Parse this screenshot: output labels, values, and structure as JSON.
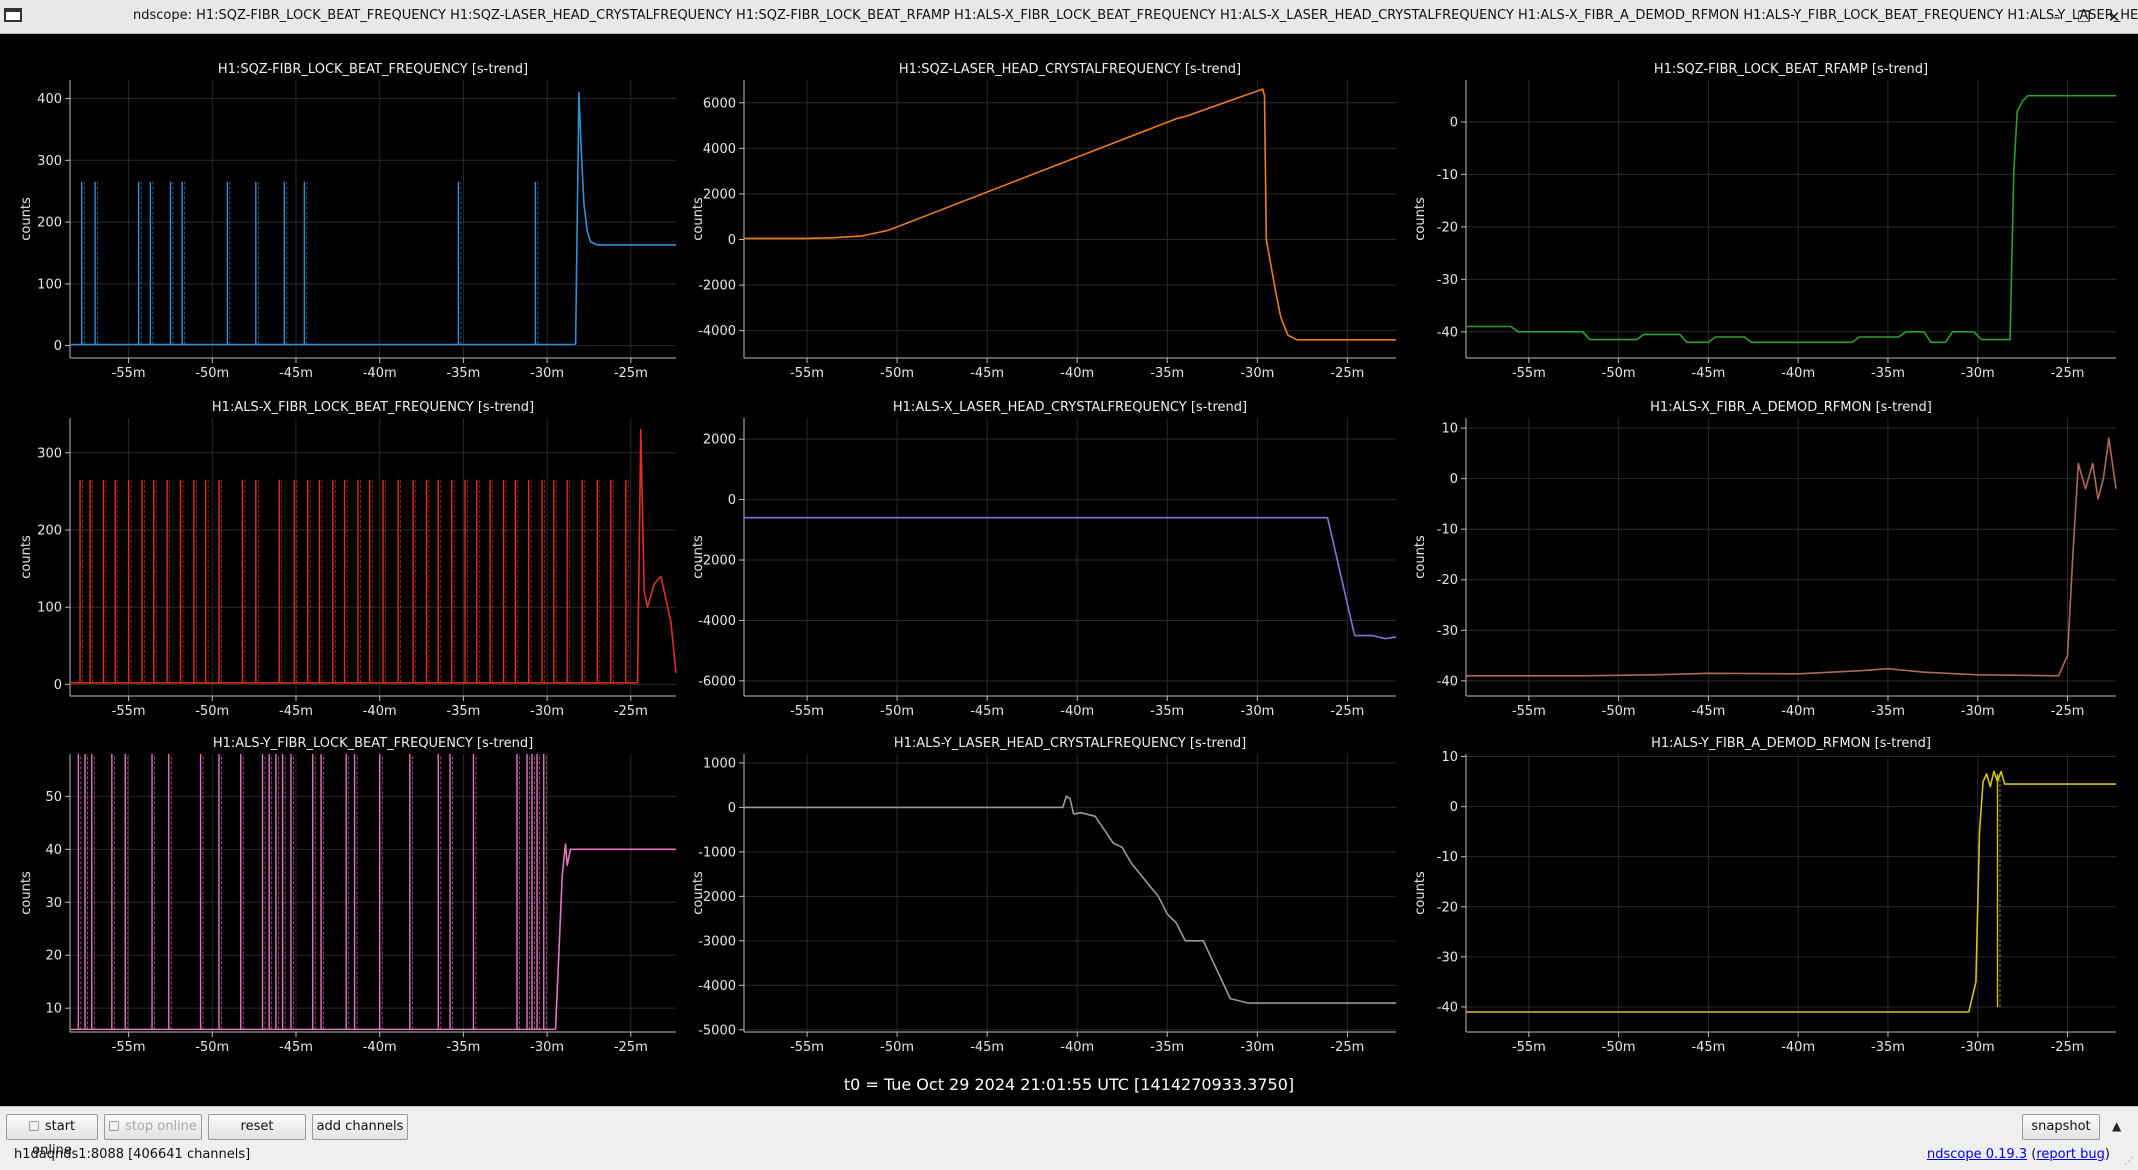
{
  "window": {
    "title": "ndscope: H1:SQZ-FIBR_LOCK_BEAT_FREQUENCY H1:SQZ-LASER_HEAD_CRYSTALFREQUENCY H1:SQZ-FIBR_LOCK_BEAT_RFAMP H1:ALS-X_FIBR_LOCK_BEAT_FREQUENCY H1:ALS-X_LASER_HEAD_CRYSTALFREQUENCY H1:ALS-X_FIBR_A_DEMOD_RFMON H1:ALS-Y_FIBR_LOCK_BEAT_FREQUENCY H1:ALS-Y_LASER_HEA",
    "controls": {
      "minimize": "–",
      "restore": "❐",
      "maximize": "□",
      "close": "✕"
    }
  },
  "t0_label": "t0 = Tue Oct 29 2024 21:01:55 UTC [1414270933.3750]",
  "buttons": {
    "start_online": "start online",
    "stop_online": "stop online",
    "reset": "reset",
    "add_channels": "add channels",
    "snapshot": "snapshot",
    "collapse": "▲"
  },
  "status": {
    "server": "h1daqnds1:8088  [406641 channels]",
    "app_link": "ndscope 0.19.3",
    "paren_open": " (",
    "bug_link": "report bug",
    "paren_close": ")"
  },
  "colors": {
    "background": "#000000",
    "grid": "#2a2a2a",
    "axis": "#bdbdbd"
  },
  "chart_data": [
    {
      "type": "line",
      "title": "H1:SQZ-FIBR_LOCK_BEAT_FREQUENCY [s-trend]",
      "ylabel": "counts",
      "color": "#2f8fd8",
      "xlim": [
        -58.5,
        -22.3
      ],
      "ylim": [
        -20,
        430
      ],
      "x_ticks": [
        -55,
        -50,
        -45,
        -40,
        -35,
        -30,
        -25
      ],
      "x_tick_labels": [
        "-55m",
        "-50m",
        "-45m",
        "-40m",
        "-35m",
        "-30m",
        "-25m"
      ],
      "y_ticks": [
        0,
        100,
        200,
        300,
        400
      ],
      "y_tick_labels": [
        "0",
        "100",
        "200",
        "300",
        "400"
      ],
      "baseline": 2,
      "spikes": [
        {
          "x": -57.8,
          "y": 265
        },
        {
          "x": -57.0,
          "y": 265
        },
        {
          "x": -54.4,
          "y": 265
        },
        {
          "x": -53.7,
          "y": 265
        },
        {
          "x": -52.5,
          "y": 265
        },
        {
          "x": -51.8,
          "y": 265
        },
        {
          "x": -49.1,
          "y": 265
        },
        {
          "x": -47.4,
          "y": 265
        },
        {
          "x": -45.7,
          "y": 265
        },
        {
          "x": -44.5,
          "y": 265
        },
        {
          "x": -35.3,
          "y": 265
        },
        {
          "x": -30.7,
          "y": 265
        }
      ],
      "series": [
        {
          "x": [
            -28.3,
            -28.1,
            -27.95,
            -27.8,
            -27.6,
            -27.4,
            -27.0,
            -26.0,
            -22.3
          ],
          "y": [
            2,
            410,
            310,
            230,
            185,
            168,
            163,
            163,
            163
          ]
        }
      ]
    },
    {
      "type": "line",
      "title": "H1:SQZ-LASER_HEAD_CRYSTALFREQUENCY [s-trend]",
      "ylabel": "counts",
      "color": "#f07d1c",
      "xlim": [
        -58.5,
        -22.3
      ],
      "ylim": [
        -5200,
        7000
      ],
      "x_ticks": [
        -55,
        -50,
        -45,
        -40,
        -35,
        -30,
        -25
      ],
      "x_tick_labels": [
        "-55m",
        "-50m",
        "-45m",
        "-40m",
        "-35m",
        "-30m",
        "-25m"
      ],
      "y_ticks": [
        -4000,
        -2000,
        0,
        2000,
        4000,
        6000
      ],
      "y_tick_labels": [
        "-4000",
        "-2000",
        "0",
        "2000",
        "4000",
        "6000"
      ],
      "series": [
        {
          "x": [
            -58.5,
            -55,
            -53.5,
            -52,
            -50.5,
            -34.5,
            -34,
            -29.7,
            -29.6,
            -29.5,
            -29.0,
            -28.7,
            -28.3,
            -27.8,
            -22.3
          ],
          "y": [
            50,
            50,
            80,
            150,
            400,
            5300,
            5400,
            6600,
            6300,
            0,
            -2200,
            -3400,
            -4200,
            -4400,
            -4400
          ]
        }
      ]
    },
    {
      "type": "line",
      "title": "H1:SQZ-FIBR_LOCK_BEAT_RFAMP [s-trend]",
      "ylabel": "counts",
      "color": "#2ca02c",
      "xlim": [
        -58.5,
        -22.3
      ],
      "ylim": [
        -45,
        8
      ],
      "x_ticks": [
        -55,
        -50,
        -45,
        -40,
        -35,
        -30,
        -25
      ],
      "x_tick_labels": [
        "-55m",
        "-50m",
        "-45m",
        "-40m",
        "-35m",
        "-30m",
        "-25m"
      ],
      "y_ticks": [
        -40,
        -30,
        -20,
        -10,
        0
      ],
      "y_tick_labels": [
        "-40",
        "-30",
        "-20",
        "-10",
        "0"
      ],
      "series": [
        {
          "x": [
            -58.5,
            -56,
            -55.6,
            -52,
            -51.6,
            -49,
            -48.6,
            -46.6,
            -46.2,
            -45.0,
            -44.6,
            -43,
            -42.6,
            -37,
            -36.6,
            -34.4,
            -34.0,
            -33,
            -32.6,
            -31.8,
            -31.4,
            -30.2,
            -29.8,
            -28.2,
            -28.0,
            -27.8,
            -27.5,
            -27.2,
            -26.8,
            -22.3
          ],
          "y": [
            -39,
            -39,
            -40,
            -40,
            -41.5,
            -41.5,
            -40.5,
            -40.5,
            -42,
            -42,
            -41,
            -41,
            -42,
            -42,
            -41,
            -41,
            -40,
            -40,
            -42,
            -42,
            -40,
            -40,
            -41.5,
            -41.5,
            -10,
            2,
            4,
            5,
            5,
            5
          ]
        }
      ]
    },
    {
      "type": "line",
      "title": "H1:ALS-X_FIBR_LOCK_BEAT_FREQUENCY [s-trend]",
      "ylabel": "counts",
      "color": "#e0301e",
      "xlim": [
        -58.5,
        -22.3
      ],
      "ylim": [
        -15,
        345
      ],
      "x_ticks": [
        -55,
        -50,
        -45,
        -40,
        -35,
        -30,
        -25
      ],
      "x_tick_labels": [
        "-55m",
        "-50m",
        "-45m",
        "-40m",
        "-35m",
        "-30m",
        "-25m"
      ],
      "y_ticks": [
        0,
        100,
        200,
        300
      ],
      "y_tick_labels": [
        "0",
        "100",
        "200",
        "300"
      ],
      "baseline": 2,
      "spikes": [
        {
          "x": -57.9,
          "y": 265
        },
        {
          "x": -57.3,
          "y": 265
        },
        {
          "x": -56.5,
          "y": 265
        },
        {
          "x": -55.8,
          "y": 265
        },
        {
          "x": -55.0,
          "y": 265
        },
        {
          "x": -54.2,
          "y": 265
        },
        {
          "x": -53.5,
          "y": 265
        },
        {
          "x": -52.7,
          "y": 265
        },
        {
          "x": -51.9,
          "y": 265
        },
        {
          "x": -51.1,
          "y": 265
        },
        {
          "x": -50.4,
          "y": 265
        },
        {
          "x": -49.6,
          "y": 265
        },
        {
          "x": -48.2,
          "y": 265
        },
        {
          "x": -47.4,
          "y": 265
        },
        {
          "x": -46.0,
          "y": 265
        },
        {
          "x": -45.1,
          "y": 265
        },
        {
          "x": -44.3,
          "y": 265
        },
        {
          "x": -43.6,
          "y": 265
        },
        {
          "x": -42.8,
          "y": 265
        },
        {
          "x": -42.1,
          "y": 265
        },
        {
          "x": -41.3,
          "y": 265
        },
        {
          "x": -40.6,
          "y": 265
        },
        {
          "x": -39.8,
          "y": 265
        },
        {
          "x": -38.9,
          "y": 265
        },
        {
          "x": -38.0,
          "y": 265
        },
        {
          "x": -37.2,
          "y": 265
        },
        {
          "x": -36.5,
          "y": 265
        },
        {
          "x": -35.7,
          "y": 265
        },
        {
          "x": -34.9,
          "y": 265
        },
        {
          "x": -34.2,
          "y": 265
        },
        {
          "x": -33.4,
          "y": 265
        },
        {
          "x": -32.6,
          "y": 265
        },
        {
          "x": -31.9,
          "y": 265
        },
        {
          "x": -31.1,
          "y": 265
        },
        {
          "x": -30.3,
          "y": 265
        },
        {
          "x": -29.6,
          "y": 265
        },
        {
          "x": -28.8,
          "y": 265
        },
        {
          "x": -27.9,
          "y": 265
        },
        {
          "x": -27.0,
          "y": 265
        },
        {
          "x": -26.2,
          "y": 265
        },
        {
          "x": -25.3,
          "y": 265
        }
      ],
      "series": [
        {
          "x": [
            -24.6,
            -24.4,
            -24.2,
            -24.0,
            -23.6,
            -23.2,
            -22.9,
            -22.6,
            -22.3
          ],
          "y": [
            2,
            330,
            120,
            100,
            130,
            140,
            110,
            80,
            15
          ]
        }
      ]
    },
    {
      "type": "line",
      "title": "H1:ALS-X_LASER_HEAD_CRYSTALFREQUENCY [s-trend]",
      "ylabel": "counts",
      "color": "#8c6fd8",
      "xlim": [
        -58.5,
        -22.3
      ],
      "ylim": [
        -6500,
        2700
      ],
      "x_ticks": [
        -55,
        -50,
        -45,
        -40,
        -35,
        -30,
        -25
      ],
      "x_tick_labels": [
        "-55m",
        "-50m",
        "-45m",
        "-40m",
        "-35m",
        "-30m",
        "-25m"
      ],
      "y_ticks": [
        -6000,
        -4000,
        -2000,
        0,
        2000
      ],
      "y_tick_labels": [
        "-6000",
        "-4000",
        "-2000",
        "0",
        "2000"
      ],
      "series": [
        {
          "x": [
            -58.5,
            -26.1,
            -24.6,
            -23.6,
            -22.9,
            -22.3
          ],
          "y": [
            -600,
            -600,
            -4500,
            -4500,
            -4600,
            -4550
          ]
        }
      ]
    },
    {
      "type": "line",
      "title": "H1:ALS-X_FIBR_A_DEMOD_RFMON [s-trend]",
      "ylabel": "counts",
      "color": "#b06a5a",
      "xlim": [
        -58.5,
        -22.3
      ],
      "ylim": [
        -43,
        12
      ],
      "x_ticks": [
        -55,
        -50,
        -45,
        -40,
        -35,
        -30,
        -25
      ],
      "x_tick_labels": [
        "-55m",
        "-50m",
        "-45m",
        "-40m",
        "-35m",
        "-30m",
        "-25m"
      ],
      "y_ticks": [
        -40,
        -30,
        -20,
        -10,
        0,
        10
      ],
      "y_tick_labels": [
        "-40",
        "-30",
        "-20",
        "-10",
        "0",
        "10"
      ],
      "series": [
        {
          "x": [
            -58.5,
            -52,
            -48,
            -45,
            -40,
            -36.5,
            -35,
            -33,
            -30,
            -25.5,
            -25.0,
            -24.7,
            -24.4,
            -24.0,
            -23.6,
            -23.3,
            -23.0,
            -22.7,
            -22.3
          ],
          "y": [
            -39,
            -39,
            -38.8,
            -38.5,
            -38.6,
            -38,
            -37.6,
            -38.3,
            -38.8,
            -39,
            -35,
            -15,
            3,
            -2,
            3,
            -4,
            0,
            8,
            -2
          ]
        }
      ]
    },
    {
      "type": "line",
      "title": "H1:ALS-Y_FIBR_LOCK_BEAT_FREQUENCY [s-trend]",
      "ylabel": "counts",
      "color": "#e377c2",
      "xlim": [
        -58.5,
        -22.3
      ],
      "ylim": [
        5.5,
        58
      ],
      "x_ticks": [
        -55,
        -50,
        -45,
        -40,
        -35,
        -30,
        -25
      ],
      "x_tick_labels": [
        "-55m",
        "-50m",
        "-45m",
        "-40m",
        "-35m",
        "-30m",
        "-25m"
      ],
      "y_ticks": [
        10,
        20,
        30,
        40,
        50
      ],
      "y_tick_labels": [
        "10",
        "20",
        "30",
        "40",
        "50"
      ],
      "baseline": 6,
      "spikes": [
        {
          "x": -58.0,
          "y": 58
        },
        {
          "x": -57.6,
          "y": 58
        },
        {
          "x": -57.2,
          "y": 58
        },
        {
          "x": -56.0,
          "y": 58
        },
        {
          "x": -55.2,
          "y": 58
        },
        {
          "x": -53.6,
          "y": 58
        },
        {
          "x": -52.6,
          "y": 58
        },
        {
          "x": -50.7,
          "y": 58
        },
        {
          "x": -49.6,
          "y": 58
        },
        {
          "x": -48.3,
          "y": 58
        },
        {
          "x": -47.0,
          "y": 58
        },
        {
          "x": -46.6,
          "y": 58
        },
        {
          "x": -46.2,
          "y": 58
        },
        {
          "x": -45.8,
          "y": 58
        },
        {
          "x": -45.3,
          "y": 58
        },
        {
          "x": -44.0,
          "y": 58
        },
        {
          "x": -43.5,
          "y": 58
        },
        {
          "x": -42.0,
          "y": 58
        },
        {
          "x": -41.5,
          "y": 58
        },
        {
          "x": -40.0,
          "y": 58
        },
        {
          "x": -38.2,
          "y": 58
        },
        {
          "x": -36.5,
          "y": 58
        },
        {
          "x": -35.8,
          "y": 58
        },
        {
          "x": -34.4,
          "y": 58
        },
        {
          "x": -31.8,
          "y": 58
        },
        {
          "x": -31.2,
          "y": 58
        },
        {
          "x": -30.9,
          "y": 58
        },
        {
          "x": -30.6,
          "y": 58
        },
        {
          "x": -30.2,
          "y": 58
        }
      ],
      "series": [
        {
          "x": [
            -29.5,
            -29.3,
            -29.1,
            -28.9,
            -28.8,
            -28.6,
            -28.3,
            -25,
            -22.3
          ],
          "y": [
            6,
            20,
            35,
            41,
            37,
            40,
            40,
            40,
            40
          ]
        }
      ]
    },
    {
      "type": "line",
      "title": "H1:ALS-Y_LASER_HEAD_CRYSTALFREQUENCY [s-trend]",
      "ylabel": "counts",
      "color": "#9a9a9a",
      "xlim": [
        -58.5,
        -22.3
      ],
      "ylim": [
        -5050,
        1200
      ],
      "x_ticks": [
        -55,
        -50,
        -45,
        -40,
        -35,
        -30,
        -25
      ],
      "x_tick_labels": [
        "-55m",
        "-50m",
        "-45m",
        "-40m",
        "-35m",
        "-30m",
        "-25m"
      ],
      "y_ticks": [
        -5000,
        -4000,
        -3000,
        -2000,
        -1000,
        0,
        1000
      ],
      "y_tick_labels": [
        "-5000",
        "-4000",
        "-3000",
        "-2000",
        "-1000",
        "0",
        "1000"
      ],
      "series": [
        {
          "x": [
            -58.5,
            -40.8,
            -40.6,
            -40.4,
            -40.2,
            -39.8,
            -39.0,
            -38.5,
            -38.0,
            -37.5,
            -37.0,
            -36.5,
            -36.0,
            -35.5,
            -35.0,
            -34.5,
            -34.0,
            -33.0,
            -31.5,
            -30.5,
            -30.0,
            -29.0,
            -22.3
          ],
          "y": [
            0,
            0,
            250,
            200,
            -150,
            -120,
            -200,
            -500,
            -800,
            -900,
            -1250,
            -1500,
            -1750,
            -2000,
            -2400,
            -2600,
            -3000,
            -3000,
            -4300,
            -4400,
            -4400,
            -4400,
            -4400
          ]
        }
      ]
    },
    {
      "type": "line",
      "title": "H1:ALS-Y_FIBR_A_DEMOD_RFMON [s-trend]",
      "ylabel": "counts",
      "color": "#d4c21c",
      "xlim": [
        -58.5,
        -22.3
      ],
      "ylim": [
        -45,
        10.5
      ],
      "x_ticks": [
        -55,
        -50,
        -45,
        -40,
        -35,
        -30,
        -25
      ],
      "x_tick_labels": [
        "-55m",
        "-50m",
        "-45m",
        "-40m",
        "-35m",
        "-30m",
        "-25m"
      ],
      "y_ticks": [
        -40,
        -30,
        -20,
        -10,
        0,
        10
      ],
      "y_tick_labels": [
        "-40",
        "-30",
        "-20",
        "-10",
        "0",
        "10"
      ],
      "spikes": [
        {
          "x": -28.9,
          "y": 6.5,
          "base": -40
        }
      ],
      "series": [
        {
          "x": [
            -58.5,
            -30.5,
            -30.1,
            -29.9,
            -29.7,
            -29.5,
            -29.3,
            -29.1,
            -28.9,
            -28.7,
            -28.5,
            -28.2,
            -27.5,
            -22.3
          ],
          "y": [
            -41,
            -41,
            -35,
            -5,
            5,
            6.5,
            4,
            7,
            5,
            7,
            4.5,
            4.5,
            4.5,
            4.5
          ]
        }
      ]
    }
  ]
}
